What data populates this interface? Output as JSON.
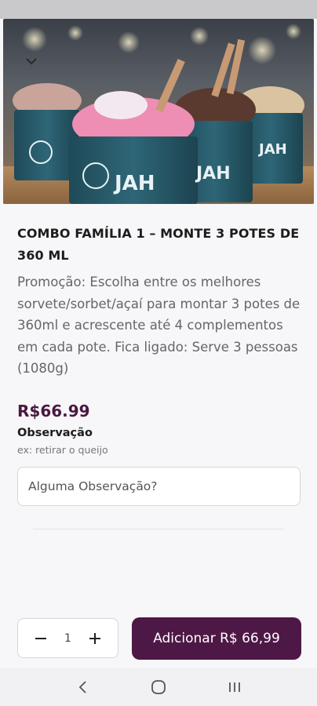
{
  "product": {
    "title": "COMBO FAMÍLIA 1 – MONTE 3 POTES DE 360 ML",
    "description": "Promoção: Escolha entre os melhores sorvete/sorbet/açaí para montar 3 potes de 360ml e acrescente até 4 complementos em cada pote. Fica ligado: Serve 3 pessoas (1080g)",
    "price": "R$66.99",
    "image_brand": "JAH"
  },
  "observation": {
    "label": "Observação",
    "hint": "ex: retirar o queijo",
    "placeholder": "Alguma Observação?",
    "value": ""
  },
  "cart": {
    "quantity": "1",
    "add_label": "Adicionar R$ 66,99"
  },
  "colors": {
    "brand": "#4e1846",
    "price": "#4a1840"
  },
  "icons": {
    "collapse": "chevron-down-icon",
    "minus": "minus-icon",
    "plus": "plus-icon",
    "nav_back": "back-icon",
    "nav_home": "home-icon",
    "nav_recents": "recents-icon"
  }
}
